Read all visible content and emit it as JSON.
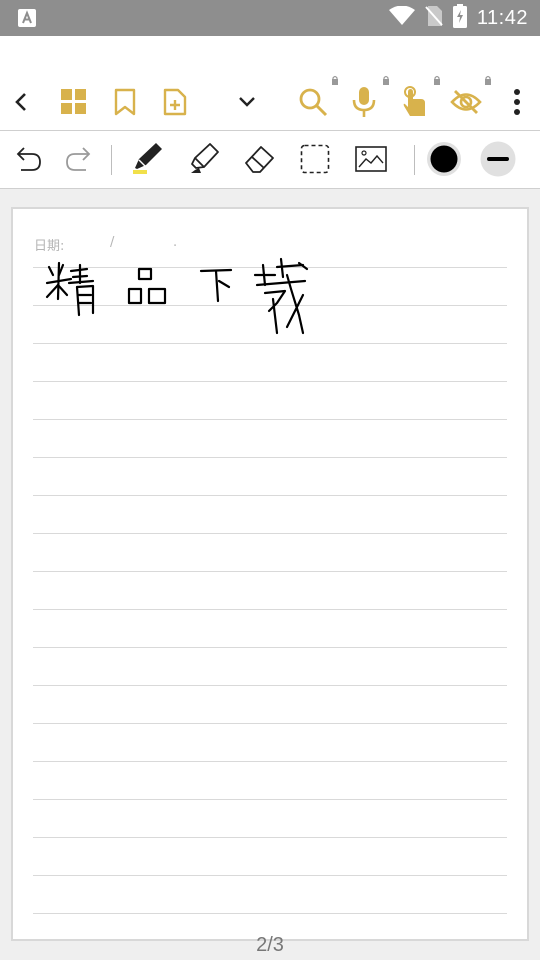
{
  "status_bar": {
    "time": "11:42",
    "icons": [
      "app-notification-icon",
      "wifi-icon",
      "no-sim-icon",
      "battery-charging-icon"
    ]
  },
  "nav_bar": {
    "icons": [
      "back-icon",
      "grid-view-icon",
      "bookmark-icon",
      "add-page-icon",
      "chevron-down-icon",
      "search-icon",
      "microphone-icon",
      "touch-hand-icon",
      "visibility-off-icon",
      "more-vert-icon"
    ],
    "locked_icons": [
      "search-icon",
      "microphone-icon",
      "touch-hand-icon",
      "visibility-off-icon"
    ],
    "accent_color": "#d8b24c"
  },
  "tool_bar": {
    "tools": [
      "undo-icon",
      "redo-icon",
      "pen-icon",
      "highlighter-icon",
      "eraser-icon",
      "lasso-select-icon",
      "insert-image-icon",
      "ink-color-swatch",
      "stroke-width-icon"
    ],
    "selected_tool": "pen-icon",
    "pen_highlight_color": "#f1e04a",
    "ink_color": "#000000"
  },
  "page": {
    "date_label": "日期:",
    "date_separator": "/",
    "date_dot": ".",
    "handwritten_text": "精品下载",
    "ruled_line_count": 18
  },
  "page_indicator": "2/3"
}
